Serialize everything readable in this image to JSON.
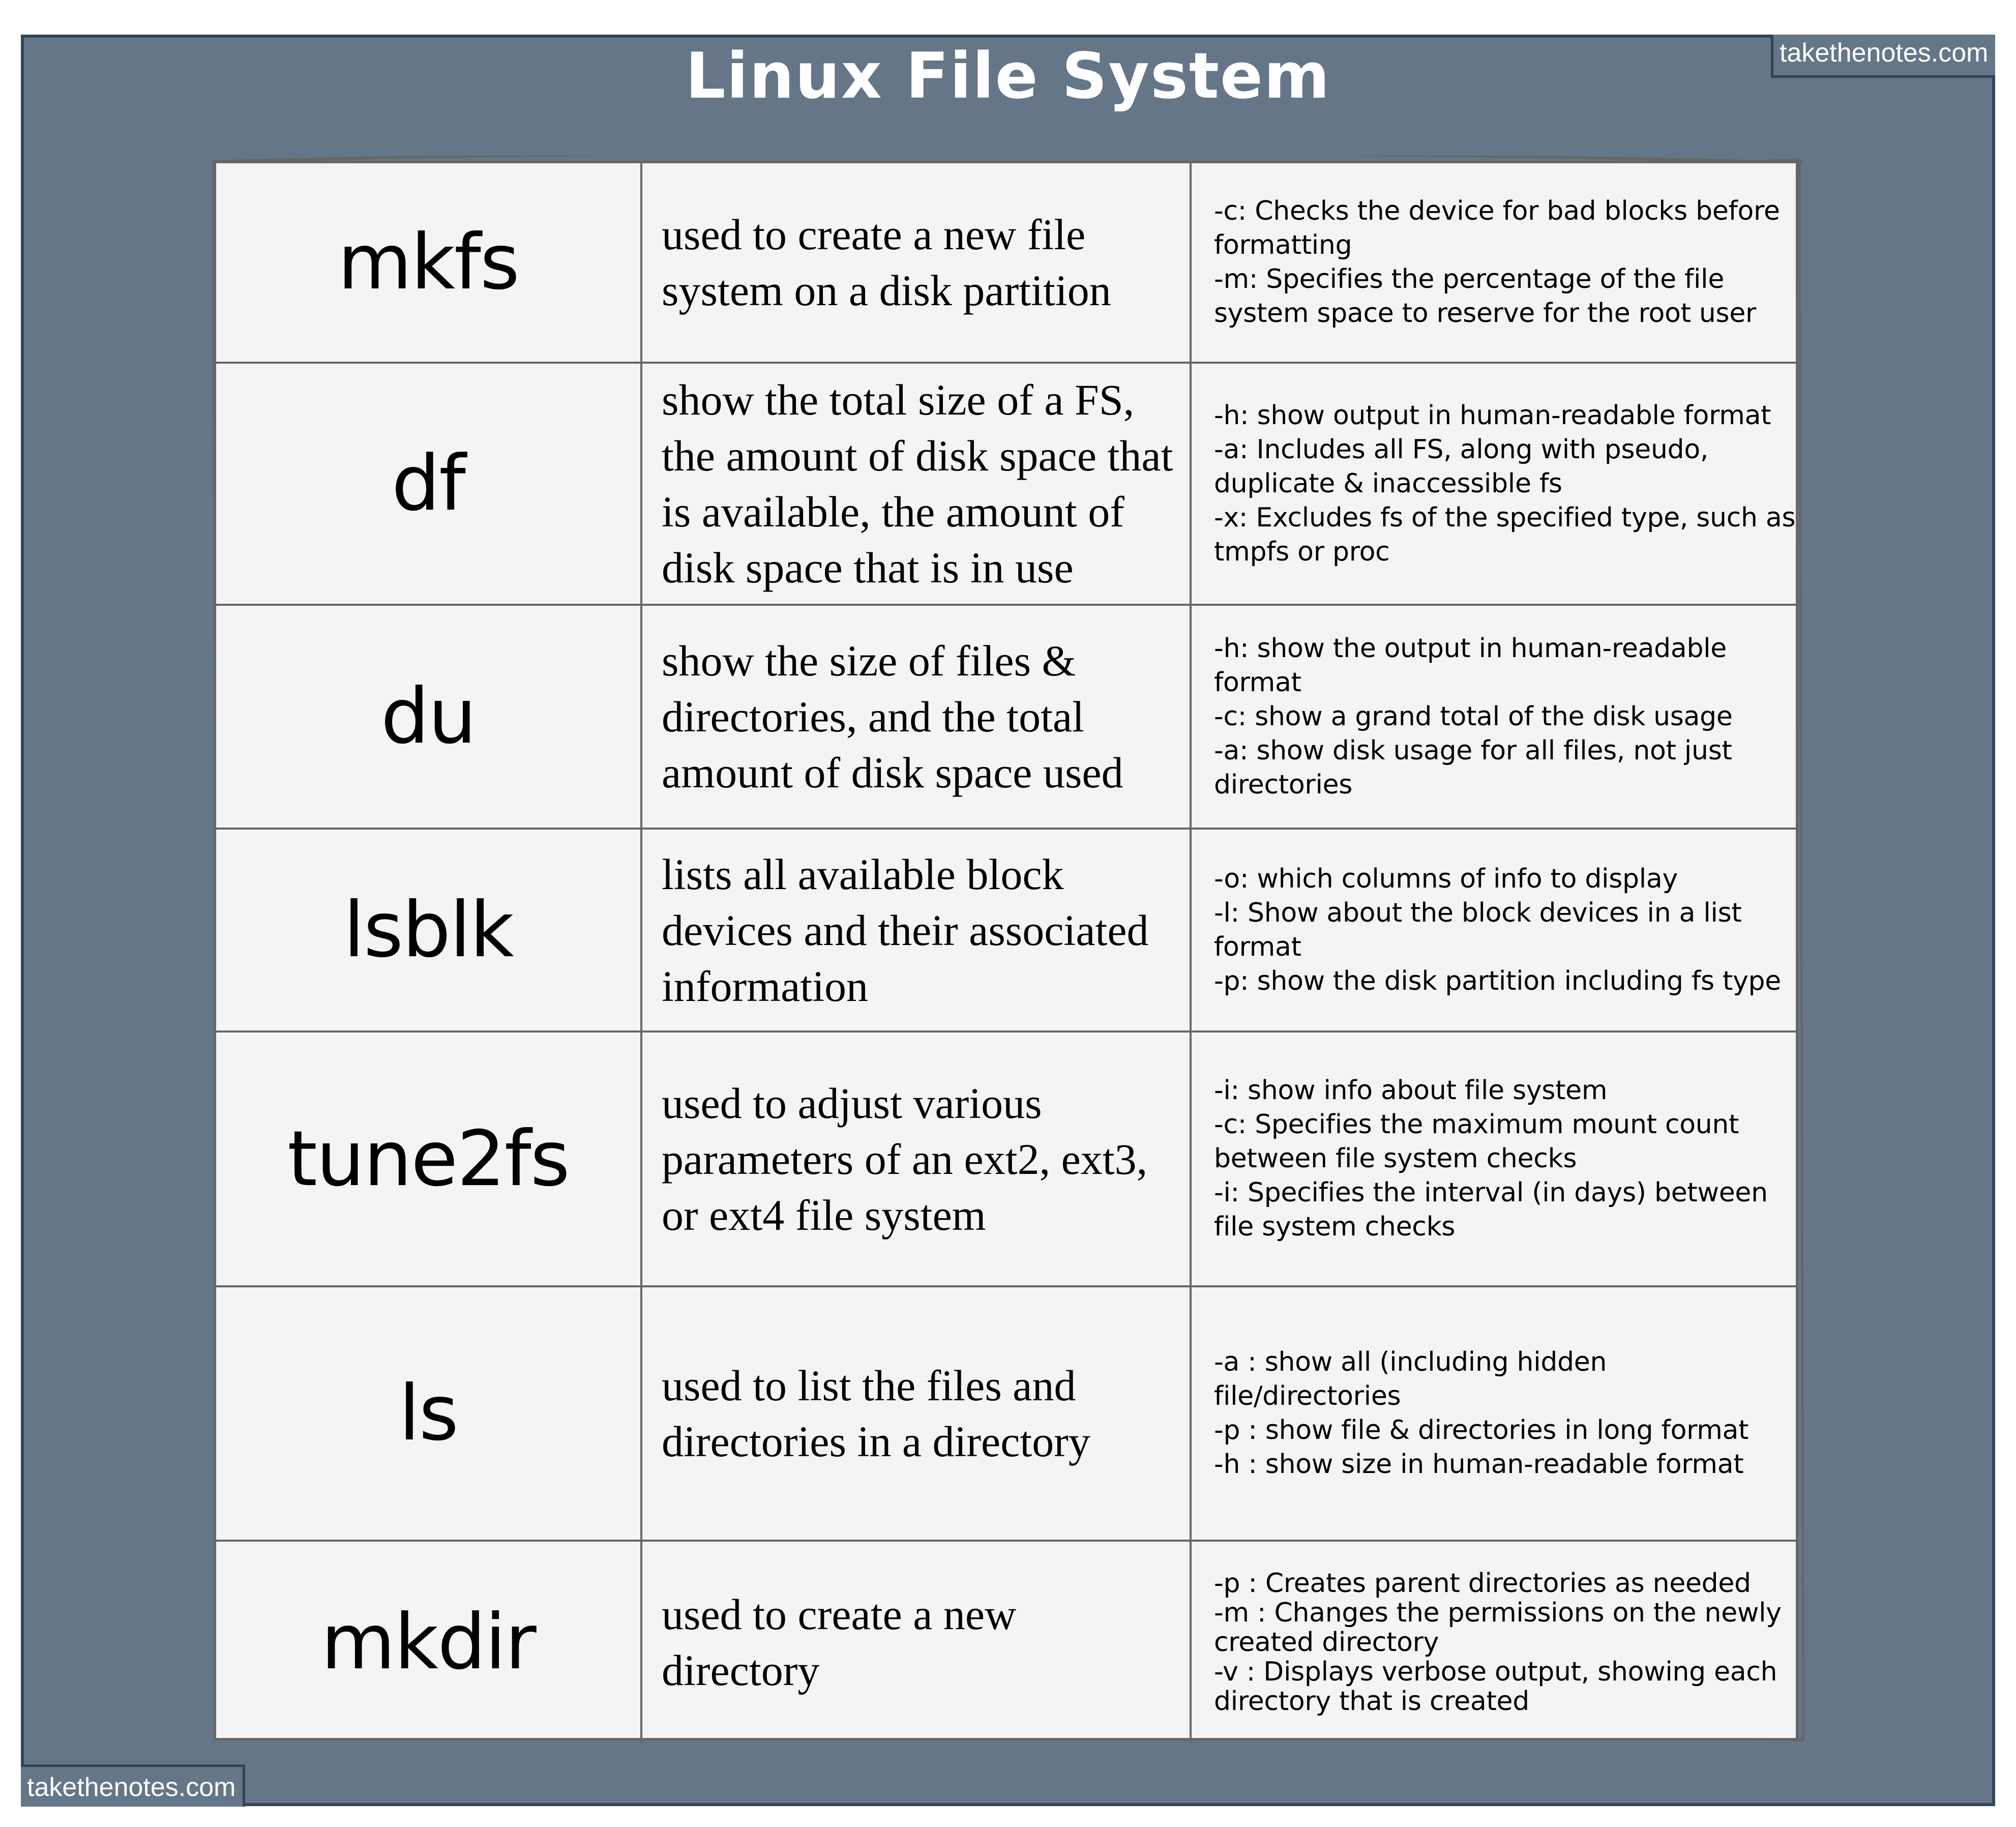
{
  "title": "Linux File System",
  "watermarks": {
    "top_right": "takethenotes.com",
    "bottom_left": "takethenotes.com"
  },
  "colors": {
    "background": "#657689",
    "frame_border": "#334455",
    "table_fill": "#f4f4f4",
    "grid_line": "#666666",
    "title_text": "#ffffff"
  },
  "rows": [
    {
      "command": "mkfs",
      "description": "used to create a new file system on a disk partition",
      "options": [
        "-c: Checks the device for bad blocks before formatting",
        "-m: Specifies the percentage of the file system space to reserve for the root user"
      ]
    },
    {
      "command": "df",
      "description": "show the total size of a FS, the amount of disk space that is available, the amount of disk space that is in use",
      "options": [
        "-h: show output in human-readable format",
        "-a: Includes all FS, along with pseudo, duplicate & inaccessible fs",
        "-x: Excludes fs of the specified type, such as tmpfs or proc"
      ]
    },
    {
      "command": "du",
      "description": "show the size of files & directories, and the total amount of disk space used",
      "options": [
        "-h: show the output in human-readable format",
        "-c: show a grand total of the disk usage",
        "-a: show disk usage for all files, not just directories"
      ]
    },
    {
      "command": "lsblk",
      "description": "lists all available block devices and their associated information",
      "options": [
        "-o: which columns of info to display",
        "-l: Show about the block devices in a list format",
        "-p: show the disk partition including fs type"
      ]
    },
    {
      "command": "tune2fs",
      "description": "used to adjust various parameters of an ext2, ext3, or ext4 file system",
      "options": [
        "-i: show info about file system",
        "-c: Specifies the maximum mount count between file system checks",
        "-i: Specifies the interval (in days) between file system checks"
      ]
    },
    {
      "command": "ls",
      "description": "used to list the files and directories in a directory",
      "options": [
        "-a : show all (including hidden file/directories",
        "-p : show file & directories in long format",
        "-h : show size in human-readable format"
      ]
    },
    {
      "command": "mkdir",
      "description": "used to create a new directory",
      "options": [
        "-p : Creates parent directories as needed",
        "-m : Changes the permissions on the newly created directory",
        "-v : Displays verbose output, showing each directory that is created"
      ]
    }
  ]
}
